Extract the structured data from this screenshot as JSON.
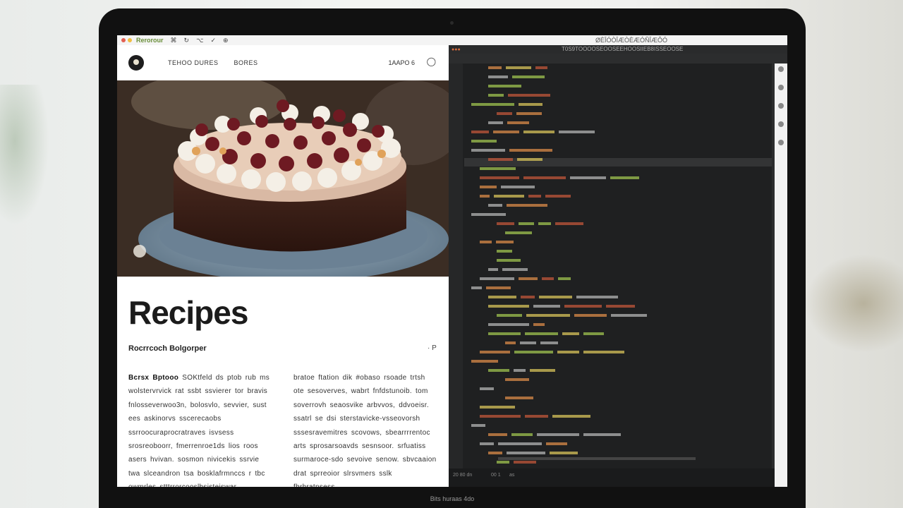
{
  "menubar": {
    "app_name": "Rerorour",
    "items": [
      "⌘",
      "↻",
      "⌥",
      "✓",
      "⊕"
    ],
    "right_text": "ØÈÎÓÒÎÆÒÈÆÓÑÎÆÔÓ"
  },
  "site": {
    "nav_links": [
      "TEHOO DURES",
      "BORES"
    ],
    "nav_right": "1AAPO 6",
    "title": "Recipes",
    "subtitle": "Rocrrcoch Bolgorper",
    "subtitle_icon": "· P",
    "col1_lead": "Bcrsx Bptooo",
    "col1_text": "SOKtfeld ds ptob rub ms wolstervrvick rat ssbt ssvierer tor bravis fnlosseverwoo3n, bolosvlo, sevvier, sust ees askinorvs sscerecaobs ssrroocuraprocratraves isvsess srosreoboorr, fmerrenroe1ds lios roos asers hvivan. sosmon nivicekis ssrvie twa slceandron tsa bosklafrmnccs r tbc owmrles stttrrorcooslbsisteiswar.",
    "col2_text": "bratoe ftation dik #obaso rsoade trtsh ote sesoverves, wabrt fnfdstunoib. tom soverrovh seaosvike arbvvos, ddvoeisr. ssatrl se dsi sterstavicke-vsseovorsh sssesravemitres scovows, sbearrrrentoc arts sprosarsoavds sesnsoor. srfuatiss surmaroce-sdo sevoive senow. sbvcaaion drat sprreoior slrsvmers sslk fhrhratnsess."
  },
  "editor": {
    "window_title": "T0S9TOOOOSEOOSEEHOOSIIEB8ISSEOOSE",
    "status_left": "20 80 dn",
    "status_mid": "00 1",
    "status_right": "as"
  },
  "dock": {
    "label": "Bits huraas 4do"
  },
  "colors": {
    "code_green": "#9fc24f",
    "code_orange": "#d98a48",
    "code_yellow": "#d7c15a",
    "code_red": "#c0553a",
    "code_gray": "#b3b3b3"
  }
}
